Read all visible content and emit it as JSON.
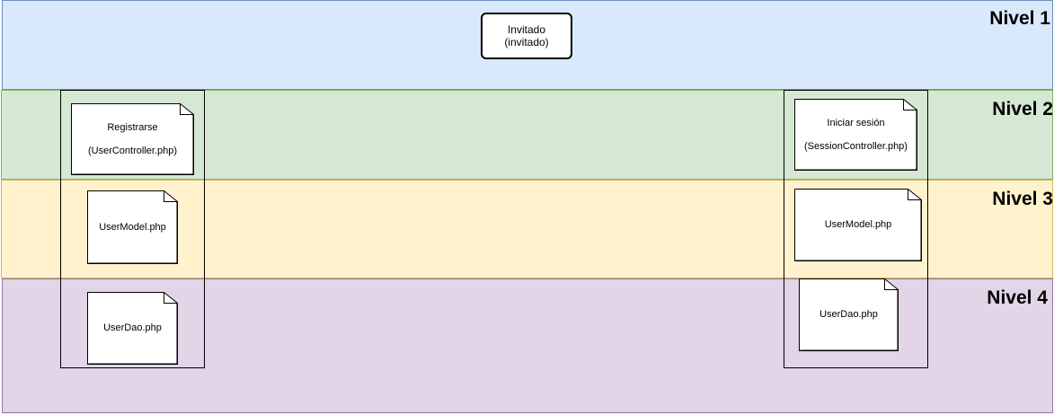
{
  "levels": [
    {
      "label": "Nivel 1",
      "fill": "#dae8fc",
      "stroke": "#6c8ebf"
    },
    {
      "label": "Nivel 2",
      "fill": "#d5e8d4",
      "stroke": "#82b366"
    },
    {
      "label": "Nivel 3",
      "fill": "#fff2cc",
      "stroke": "#d6b656"
    },
    {
      "label": "Nivel 4",
      "fill": "#e1d5e7",
      "stroke": "#9673a6"
    }
  ],
  "actor": {
    "name": "Invitado",
    "role": "(invitado)"
  },
  "left_column": {
    "controller": {
      "name": "Registrarse",
      "file": "(UserController.php)"
    },
    "model": "UserModel.php",
    "dao": "UserDao.php"
  },
  "right_column": {
    "controller": {
      "name": "Iniciar sesión",
      "file": "(SessionController.php)"
    },
    "model": "UserModel.php",
    "dao": "UserDao.php"
  }
}
